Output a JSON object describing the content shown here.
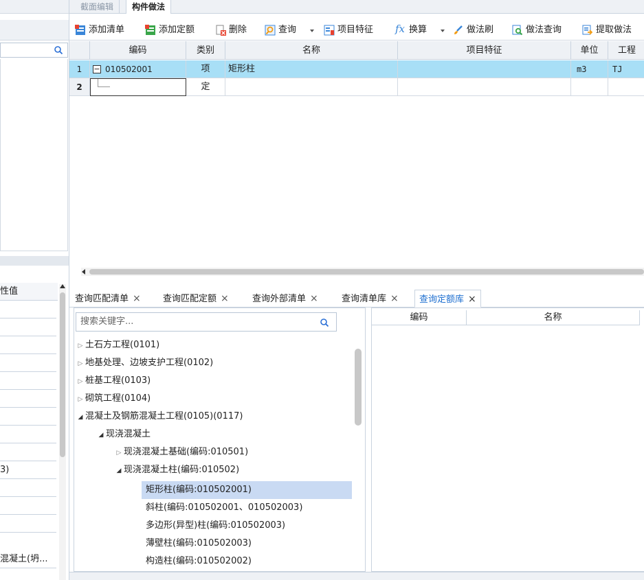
{
  "left_panel": {
    "prop_header": "性值",
    "rows": [
      "",
      "",
      "",
      "",
      "",
      "",
      "",
      "",
      "",
      "3)",
      "",
      "",
      "",
      "混凝土(坍..."
    ]
  },
  "top_tabs": [
    {
      "label": "截面编辑",
      "active": false
    },
    {
      "label": "构件做法",
      "active": true
    }
  ],
  "toolbar": {
    "add_list": "添加清单",
    "add_quota": "添加定额",
    "delete": "删除",
    "query": "查询",
    "item_feature": "项目特征",
    "convert": "换算",
    "method_brush": "做法刷",
    "method_query": "做法查询",
    "extract_method": "提取做法"
  },
  "grid": {
    "headers": [
      "编码",
      "类别",
      "名称",
      "项目特征",
      "单位",
      "工程"
    ],
    "rows": [
      {
        "num": "1",
        "code": "010502001",
        "type": "项",
        "name": "矩形柱",
        "feature": "",
        "unit": "m3",
        "expr": "TJ"
      },
      {
        "num": "2",
        "code": "",
        "type": "定",
        "name": "",
        "feature": "",
        "unit": "",
        "expr": ""
      }
    ]
  },
  "bottom_tabs": [
    {
      "label": "查询匹配清单",
      "active": false
    },
    {
      "label": "查询匹配定额",
      "active": false
    },
    {
      "label": "查询外部清单",
      "active": false
    },
    {
      "label": "查询清单库",
      "active": false
    },
    {
      "label": "查询定额库",
      "active": true
    }
  ],
  "tree": {
    "search_placeholder": "搜索关键字...",
    "nodes": [
      {
        "label": "土石方工程(0101)",
        "level": 0,
        "expanded": false
      },
      {
        "label": "地基处理、边坡支护工程(0102)",
        "level": 0,
        "expanded": false
      },
      {
        "label": "桩基工程(0103)",
        "level": 0,
        "expanded": false
      },
      {
        "label": "砌筑工程(0104)",
        "level": 0,
        "expanded": false
      },
      {
        "label": "混凝土及钢筋混凝土工程(0105)(0117)",
        "level": 0,
        "expanded": true
      },
      {
        "label": "现浇混凝土",
        "level": 1,
        "expanded": true
      },
      {
        "label": "现浇混凝土基础(编码:010501)",
        "level": 2,
        "expanded": false
      },
      {
        "label": "现浇混凝土柱(编码:010502)",
        "level": 2,
        "expanded": true
      },
      {
        "label": "矩形柱(编码:010502001)",
        "level": 3,
        "selected": true
      },
      {
        "label": "斜柱(编码:010502001、010502003)",
        "level": 3
      },
      {
        "label": "多边形(异型)柱(编码:010502003)",
        "level": 3
      },
      {
        "label": "薄壁柱(编码:010502003)",
        "level": 3
      },
      {
        "label": "构造柱(编码:010502002)",
        "level": 3
      }
    ]
  },
  "result_grid": {
    "headers": [
      "编码",
      "名称"
    ]
  },
  "colors": {
    "selected_row": "#a8dff6",
    "tree_selected": "#c9daf3",
    "active_tab_text": "#1e6fd0"
  }
}
